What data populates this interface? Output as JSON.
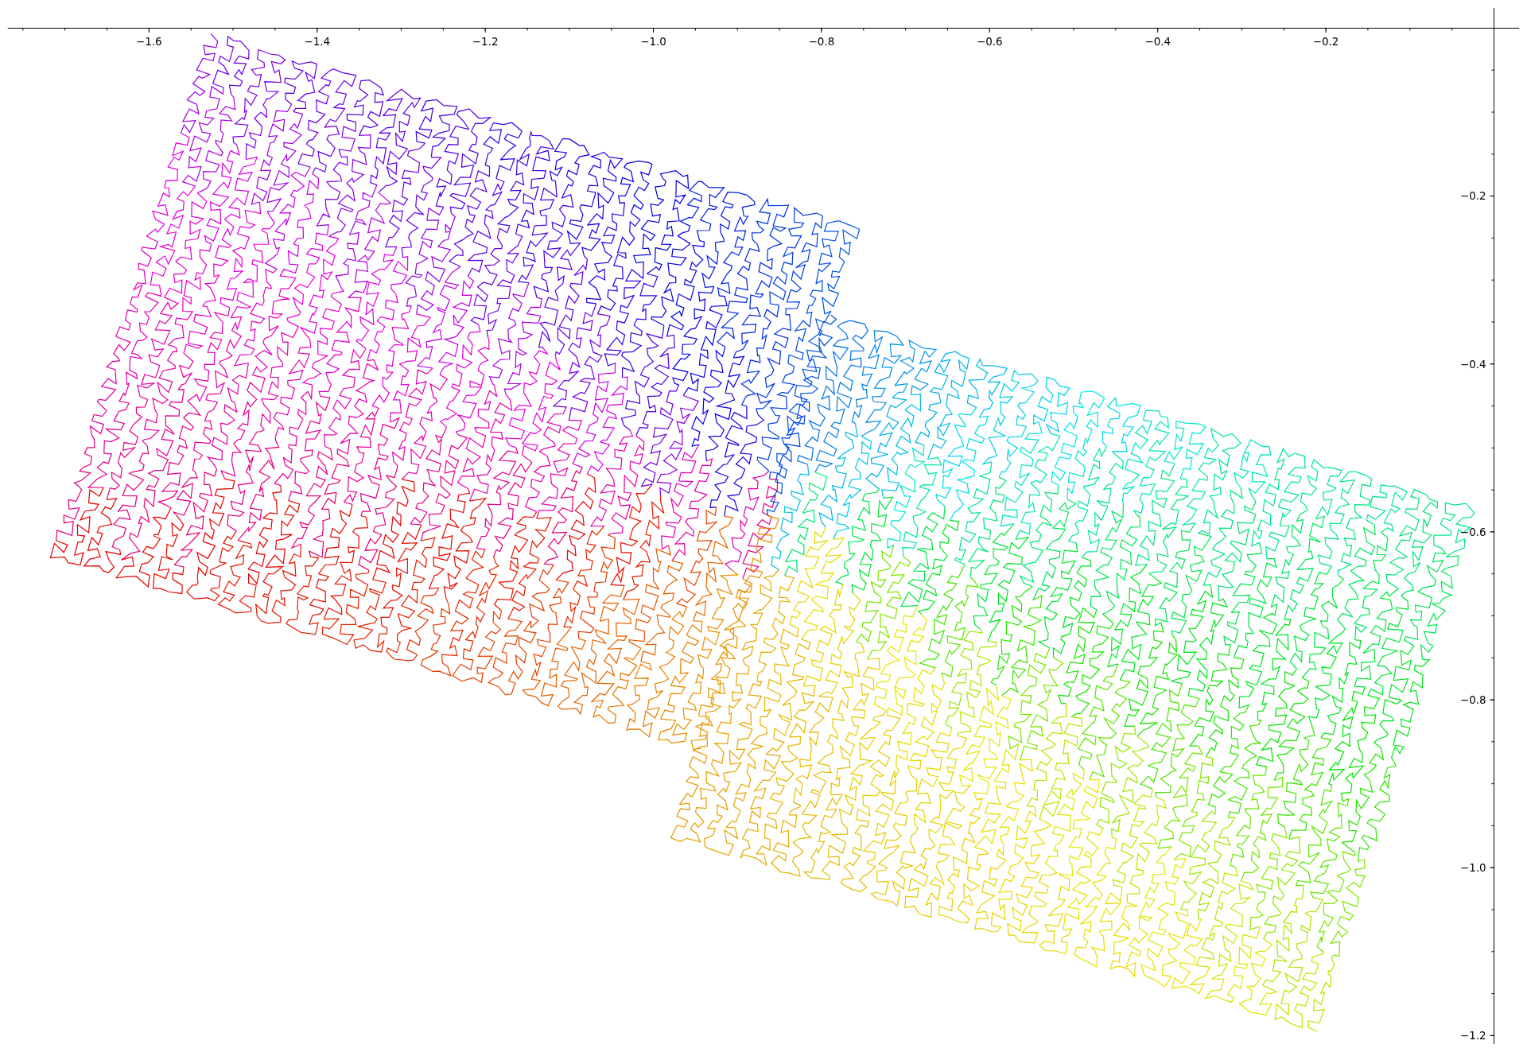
{
  "chart_data": {
    "type": "line",
    "xlim": [
      -1.768,
      0.03
    ],
    "ylim": [
      -1.21,
      0.024
    ],
    "xticks": [
      {
        "value": -1.6,
        "label": "−1.6"
      },
      {
        "value": -1.4,
        "label": "−1.4"
      },
      {
        "value": -1.2,
        "label": "−1.2"
      },
      {
        "value": -1.0,
        "label": "−1.0"
      },
      {
        "value": -0.8,
        "label": "−0.8"
      },
      {
        "value": -0.6,
        "label": "−0.6"
      },
      {
        "value": -0.4,
        "label": "−0.4"
      },
      {
        "value": -0.2,
        "label": "−0.2"
      }
    ],
    "yticks": [
      {
        "value": -0.2,
        "label": "−0.2"
      },
      {
        "value": -0.4,
        "label": "−0.4"
      },
      {
        "value": -0.6,
        "label": "−0.6"
      },
      {
        "value": -0.8,
        "label": "−0.8"
      },
      {
        "value": -1.0,
        "label": "−1.0"
      },
      {
        "value": -1.2,
        "label": "−1.2"
      }
    ]
  }
}
